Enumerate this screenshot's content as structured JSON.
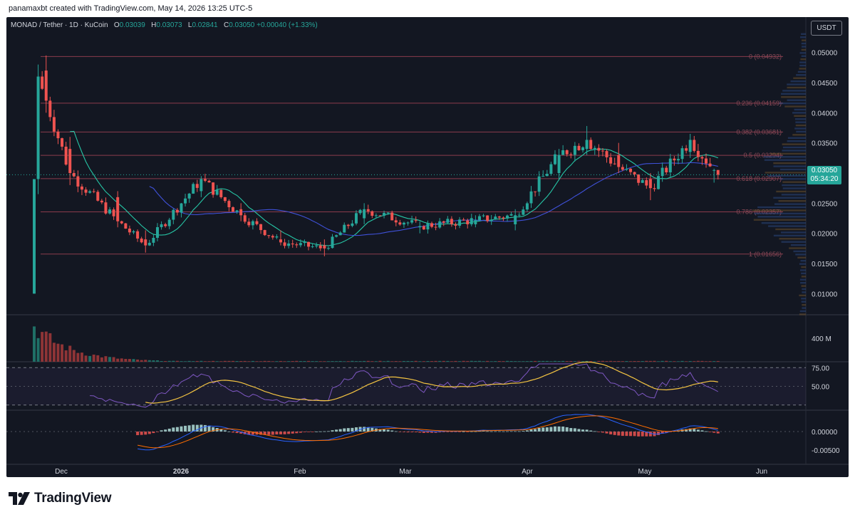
{
  "attribution": "panamaxbt created with TradingView.com, May 14, 2026 13:25 UTC-5",
  "legend": {
    "symbol": "MONAD / Tether · 1D · KuCoin",
    "o_label": "O",
    "o_value": "0.03039",
    "h_label": "H",
    "h_value": "0.03073",
    "l_label": "L",
    "l_value": "0.02841",
    "c_label": "C",
    "c_value": "0.03050",
    "change": "+0.00040 (+1.33%)"
  },
  "currency": "USDT",
  "last_price": "0.03050",
  "countdown": "05:34:20",
  "brand": "TradingView",
  "colors": {
    "up": "#26a69a",
    "down": "#ef5350",
    "background": "#131722",
    "fib": "#b2475b",
    "ma_teal": "#26c6a6",
    "ma_blue": "#3f51d8",
    "rsi": "#7e57c2",
    "rsi_ma": "#f5c542",
    "macd": "#2962ff",
    "signal": "#ff6d00"
  },
  "chart_data": {
    "type": "candlestick",
    "title": "MONAD / Tether · 1D · KuCoin",
    "price_axis": {
      "ticks": [
        "0.05000",
        "0.04500",
        "0.04000",
        "0.03500",
        "0.03000",
        "0.02500",
        "0.02000",
        "0.01500",
        "0.01000"
      ],
      "range": [
        0.0065,
        0.0535
      ]
    },
    "time_axis": {
      "ticks": [
        "Dec",
        "2026",
        "Feb",
        "Mar",
        "Apr",
        "May",
        "Jun"
      ]
    },
    "ohlc_anchors": [
      {
        "date": "2025-11-24",
        "open": 0.01,
        "high": 0.029,
        "low": 0.01,
        "close": 0.029
      },
      {
        "date": "2025-11-25",
        "open": 0.029,
        "high": 0.048,
        "low": 0.0265,
        "close": 0.046
      },
      {
        "date": "2025-11-27",
        "open": 0.047,
        "high": 0.0495,
        "low": 0.04,
        "close": 0.042
      },
      {
        "date": "2025-12-03",
        "open": 0.034,
        "high": 0.036,
        "low": 0.028,
        "close": 0.03
      },
      {
        "date": "2025-12-15",
        "open": 0.026,
        "high": 0.027,
        "low": 0.021,
        "close": 0.022
      },
      {
        "date": "2025-12-22",
        "open": 0.019,
        "high": 0.0205,
        "low": 0.0168,
        "close": 0.018
      },
      {
        "date": "2026-01-05",
        "open": 0.027,
        "high": 0.0295,
        "low": 0.026,
        "close": 0.029
      },
      {
        "date": "2026-01-15",
        "open": 0.024,
        "high": 0.025,
        "low": 0.022,
        "close": 0.023
      },
      {
        "date": "2026-01-25",
        "open": 0.019,
        "high": 0.0205,
        "low": 0.018,
        "close": 0.0185
      },
      {
        "date": "2026-02-05",
        "open": 0.018,
        "high": 0.019,
        "low": 0.0162,
        "close": 0.0175
      },
      {
        "date": "2026-02-15",
        "open": 0.0225,
        "high": 0.025,
        "low": 0.0215,
        "close": 0.024
      },
      {
        "date": "2026-03-01",
        "open": 0.021,
        "high": 0.022,
        "low": 0.02,
        "close": 0.0212
      },
      {
        "date": "2026-03-15",
        "open": 0.0215,
        "high": 0.023,
        "low": 0.021,
        "close": 0.0222
      },
      {
        "date": "2026-03-25",
        "open": 0.0215,
        "high": 0.024,
        "low": 0.0205,
        "close": 0.023
      },
      {
        "date": "2026-04-05",
        "open": 0.03,
        "high": 0.034,
        "low": 0.029,
        "close": 0.033
      },
      {
        "date": "2026-04-12",
        "open": 0.034,
        "high": 0.0378,
        "low": 0.033,
        "close": 0.0355
      },
      {
        "date": "2026-04-20",
        "open": 0.033,
        "high": 0.035,
        "low": 0.03,
        "close": 0.031
      },
      {
        "date": "2026-04-28",
        "open": 0.029,
        "high": 0.03,
        "low": 0.0255,
        "close": 0.0275
      },
      {
        "date": "2026-05-08",
        "open": 0.0335,
        "high": 0.0365,
        "low": 0.0325,
        "close": 0.0355
      },
      {
        "date": "2026-05-14",
        "open": 0.03039,
        "high": 0.03073,
        "low": 0.02841,
        "close": 0.0305
      }
    ],
    "fibonacci": [
      {
        "label": "0 (0.04932)",
        "value": 0.04932
      },
      {
        "label": "0.236 (0.04159)",
        "value": 0.04159
      },
      {
        "label": "0.382 (0.03681)",
        "value": 0.03681
      },
      {
        "label": "0.5 (0.03294)",
        "value": 0.03294
      },
      {
        "label": "0.618 (0.02907)",
        "value": 0.02907
      },
      {
        "label": "0.786 (0.02357)",
        "value": 0.02357
      },
      {
        "label": "1 (0.01656)",
        "value": 0.01656
      }
    ],
    "volume": {
      "axis_label": "400 M"
    },
    "rsi": {
      "levels": [
        "75.00",
        "50.00"
      ],
      "range": [
        20,
        80
      ]
    },
    "macd": {
      "ticks": [
        "0.00000",
        "-0.00500"
      ]
    },
    "grid": false,
    "legend_position": "top-left"
  }
}
